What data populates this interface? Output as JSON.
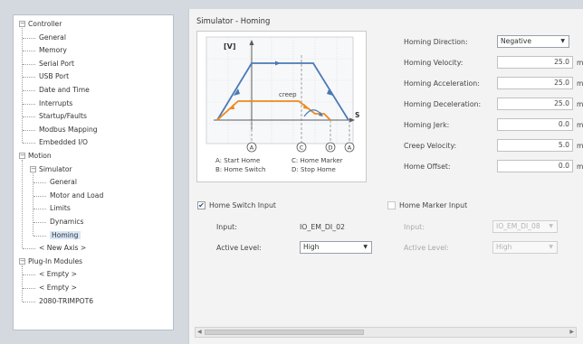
{
  "tree": [
    {
      "label": "Controller",
      "box": "−",
      "level": 0
    },
    {
      "label": "General",
      "level": 1
    },
    {
      "label": "Memory",
      "level": 1
    },
    {
      "label": "Serial Port",
      "level": 1
    },
    {
      "label": "USB Port",
      "level": 1
    },
    {
      "label": "Date and Time",
      "level": 1
    },
    {
      "label": "Interrupts",
      "level": 1
    },
    {
      "label": "Startup/Faults",
      "level": 1
    },
    {
      "label": "Modbus Mapping",
      "level": 1
    },
    {
      "label": "Embedded I/O",
      "level": 1
    },
    {
      "label": "Motion",
      "box": "−",
      "level": 0
    },
    {
      "label": "Simulator",
      "box": "−",
      "level": 1
    },
    {
      "label": "General",
      "level": 2
    },
    {
      "label": "Motor and Load",
      "level": 2
    },
    {
      "label": "Limits",
      "level": 2
    },
    {
      "label": "Dynamics",
      "level": 2
    },
    {
      "label": "Homing",
      "level": 2,
      "selected": true
    },
    {
      "label": "< New Axis >",
      "level": 1
    },
    {
      "label": "Plug-In Modules",
      "box": "−",
      "level": 0
    },
    {
      "label": "< Empty >",
      "level": 1
    },
    {
      "label": "< Empty >",
      "level": 1
    },
    {
      "label": "2080-TRIMPOT6",
      "level": 1
    }
  ],
  "main": {
    "title": "Simulator - Homing",
    "diagram": {
      "axis_v": "[V]",
      "axis_s": "S",
      "creep": "creep",
      "markers": [
        "A",
        "B",
        "C",
        "D",
        "A"
      ],
      "legend": [
        "A: Start Home",
        "C: Home Marker",
        "B: Home Switch",
        "D: Stop Home"
      ]
    },
    "params": [
      {
        "label": "Homing Direction:",
        "type": "select",
        "value": "Negative"
      },
      {
        "label": "Homing Velocity:",
        "value": "25.0",
        "unit": "m"
      },
      {
        "label": "Homing Acceleration:",
        "value": "25.0",
        "unit": "m"
      },
      {
        "label": "Homing Deceleration:",
        "value": "25.0",
        "unit": "m"
      },
      {
        "label": "Homing Jerk:",
        "value": "0.0",
        "unit": "m"
      },
      {
        "label": "Creep Velocity:",
        "value": "5.0",
        "unit": "m"
      },
      {
        "label": "Home Offset:",
        "value": "0.0",
        "unit": "m"
      }
    ],
    "home_switch": {
      "checkbox_label": "Home Switch Input",
      "checked": "✔",
      "input_label": "Input:",
      "input_value": "IO_EM_DI_02",
      "level_label": "Active Level:",
      "level_value": "High"
    },
    "home_marker": {
      "checkbox_label": "Home Marker Input",
      "input_label": "Input:",
      "input_value": "IO_EM_DI_08",
      "level_label": "Active Level:",
      "level_value": "High"
    }
  },
  "colors": {
    "blue_curve": "#4a79b5",
    "orange_curve": "#ee8a1e",
    "diagram_grid": "#d9dde3"
  }
}
